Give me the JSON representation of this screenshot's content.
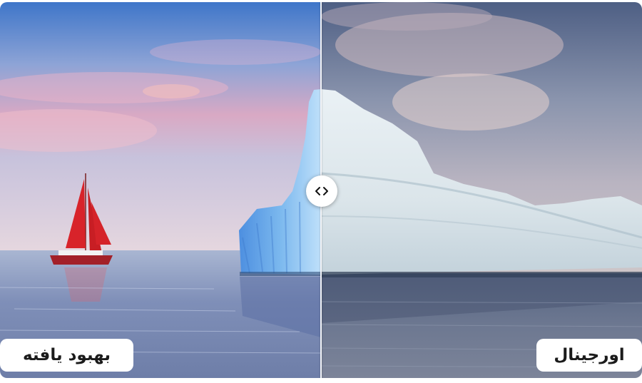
{
  "comparison": {
    "left_label": "بهبود یافته",
    "right_label": "اورجینال",
    "handle_icon": "chevron-left-right-icon"
  },
  "colors": {
    "handle_bg": "#ffffff",
    "divider": "#f2f4f8",
    "label_text": "#1b1b1b"
  }
}
